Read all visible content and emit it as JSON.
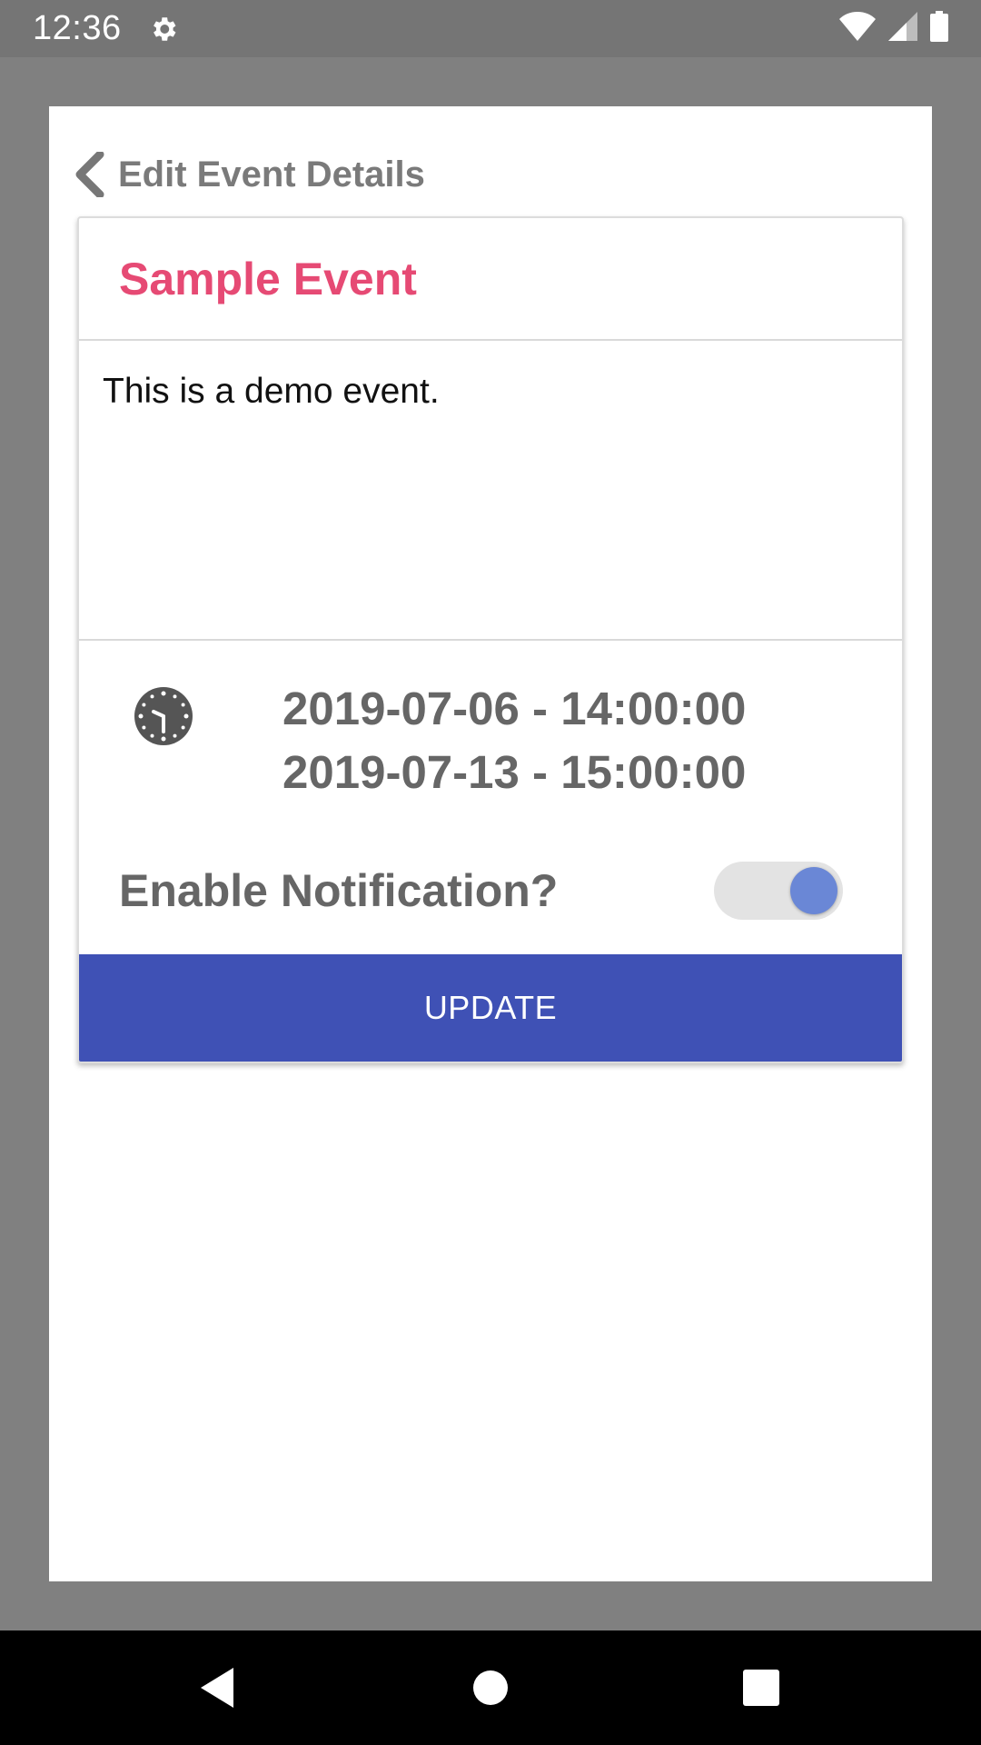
{
  "status_bar": {
    "time": "12:36",
    "icons": [
      "settings-gear-icon",
      "wifi-icon",
      "signal-icon",
      "battery-icon"
    ]
  },
  "dialog": {
    "title": "Edit Event Details",
    "back_icon": "chevron-left-icon"
  },
  "event": {
    "title": "Sample Event",
    "description": "This is a demo event.",
    "start": "2019-07-06 - 14:00:00",
    "end": "2019-07-13 - 15:00:00",
    "time_icon": "clock-icon"
  },
  "notification": {
    "label": "Enable Notification?",
    "enabled": true
  },
  "actions": {
    "update_label": "UPDATE"
  },
  "nav_bar": {
    "icons": [
      "back-triangle-icon",
      "home-circle-icon",
      "recents-square-icon"
    ]
  },
  "colors": {
    "accent_title": "#e64a74",
    "primary_button": "#3f51b5",
    "toggle_knob": "#6a87d6",
    "text_gray": "#666666"
  }
}
